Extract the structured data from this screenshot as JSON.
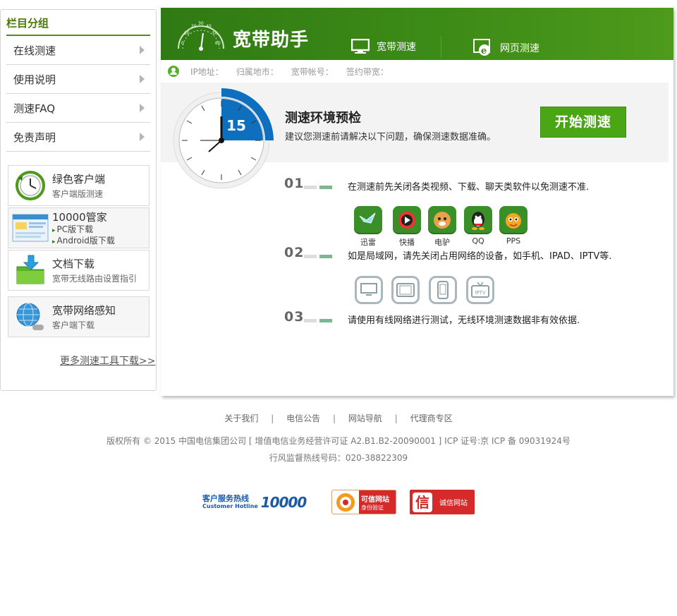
{
  "sidebar": {
    "title": "栏目分组",
    "menu": [
      {
        "label": "在线测速"
      },
      {
        "label": "使用说明"
      },
      {
        "label": "测速FAQ"
      },
      {
        "label": "免责声明"
      }
    ],
    "tools": [
      {
        "title": "绿色客户端",
        "sub": "客户端版测速"
      },
      {
        "title": "10000管家",
        "links": [
          "PC版下载",
          "Android版下载"
        ]
      },
      {
        "title": "文档下载",
        "sub": "宽带无线路由设置指引"
      },
      {
        "title": "宽带网络感知",
        "sub": "客户端下载"
      }
    ],
    "more": "更多测速工具下载>>"
  },
  "header": {
    "brand": "宽带助手",
    "gauge_ticks": [
      "0",
      "10",
      "20",
      "30",
      "40",
      "50",
      "60"
    ],
    "tabs": [
      {
        "label": "宽带测速"
      },
      {
        "label": "网页测速"
      }
    ]
  },
  "info": {
    "ip_label": "IP地址：",
    "region_label": "归属地市：",
    "account_label": "宽带帐号：",
    "bandwidth_label": "签约带宽："
  },
  "precheck": {
    "timer": "15",
    "title": "测速环境预检",
    "desc": "建议您测速前请解决以下问题，确保测速数据准确。",
    "start_button": "开始测速"
  },
  "steps": [
    {
      "num": "01",
      "text": "在测速前先关闭各类视频、下载、聊天类软件以免测速不准."
    },
    {
      "num": "02",
      "text": "如是局域网，请先关闭占用网络的设备，如手机、IPAD、IPTV等."
    },
    {
      "num": "03",
      "text": "请使用有线网络进行测试，无线环境测速数据非有效依据."
    }
  ],
  "apps": [
    {
      "label": "迅雷",
      "icon": "xunlei-icon",
      "color": "#2e8a1a"
    },
    {
      "label": "快播",
      "icon": "kuaibo-icon",
      "color": "#2e8a1a"
    },
    {
      "label": "电驴",
      "icon": "emule-icon",
      "color": "#2e8a1a"
    },
    {
      "label": "QQ",
      "icon": "qq-icon",
      "color": "#2e8a1a"
    },
    {
      "label": "PPS",
      "icon": "pps-icon",
      "color": "#2e8a1a"
    }
  ],
  "device_iptv_label": "IPTV",
  "footer": {
    "links": [
      "关于我们",
      "电信公告",
      "网站导航",
      "代理商专区"
    ],
    "separator": "|",
    "copyright": "版权所有 © 2015 中国电信集团公司 [ 增值电信业务经营许可证 A2.B1.B2-20090001 ] ICP 证号:京 ICP 备 09031924号",
    "hotline": "行风监督热线号码：020-38822309",
    "badges": {
      "hotline_cn": "客户服务热线",
      "hotline_en": "Customer Hotline",
      "hotline_num": "10000",
      "trusted_title": "可信网站",
      "trusted_sub": "身份验证",
      "integrity_char": "信",
      "integrity_title": "诚信网站"
    }
  },
  "colors": {
    "brand_green": "#3d8b17",
    "button_green": "#4aa615",
    "timer_blue": "#0e6fbe"
  }
}
